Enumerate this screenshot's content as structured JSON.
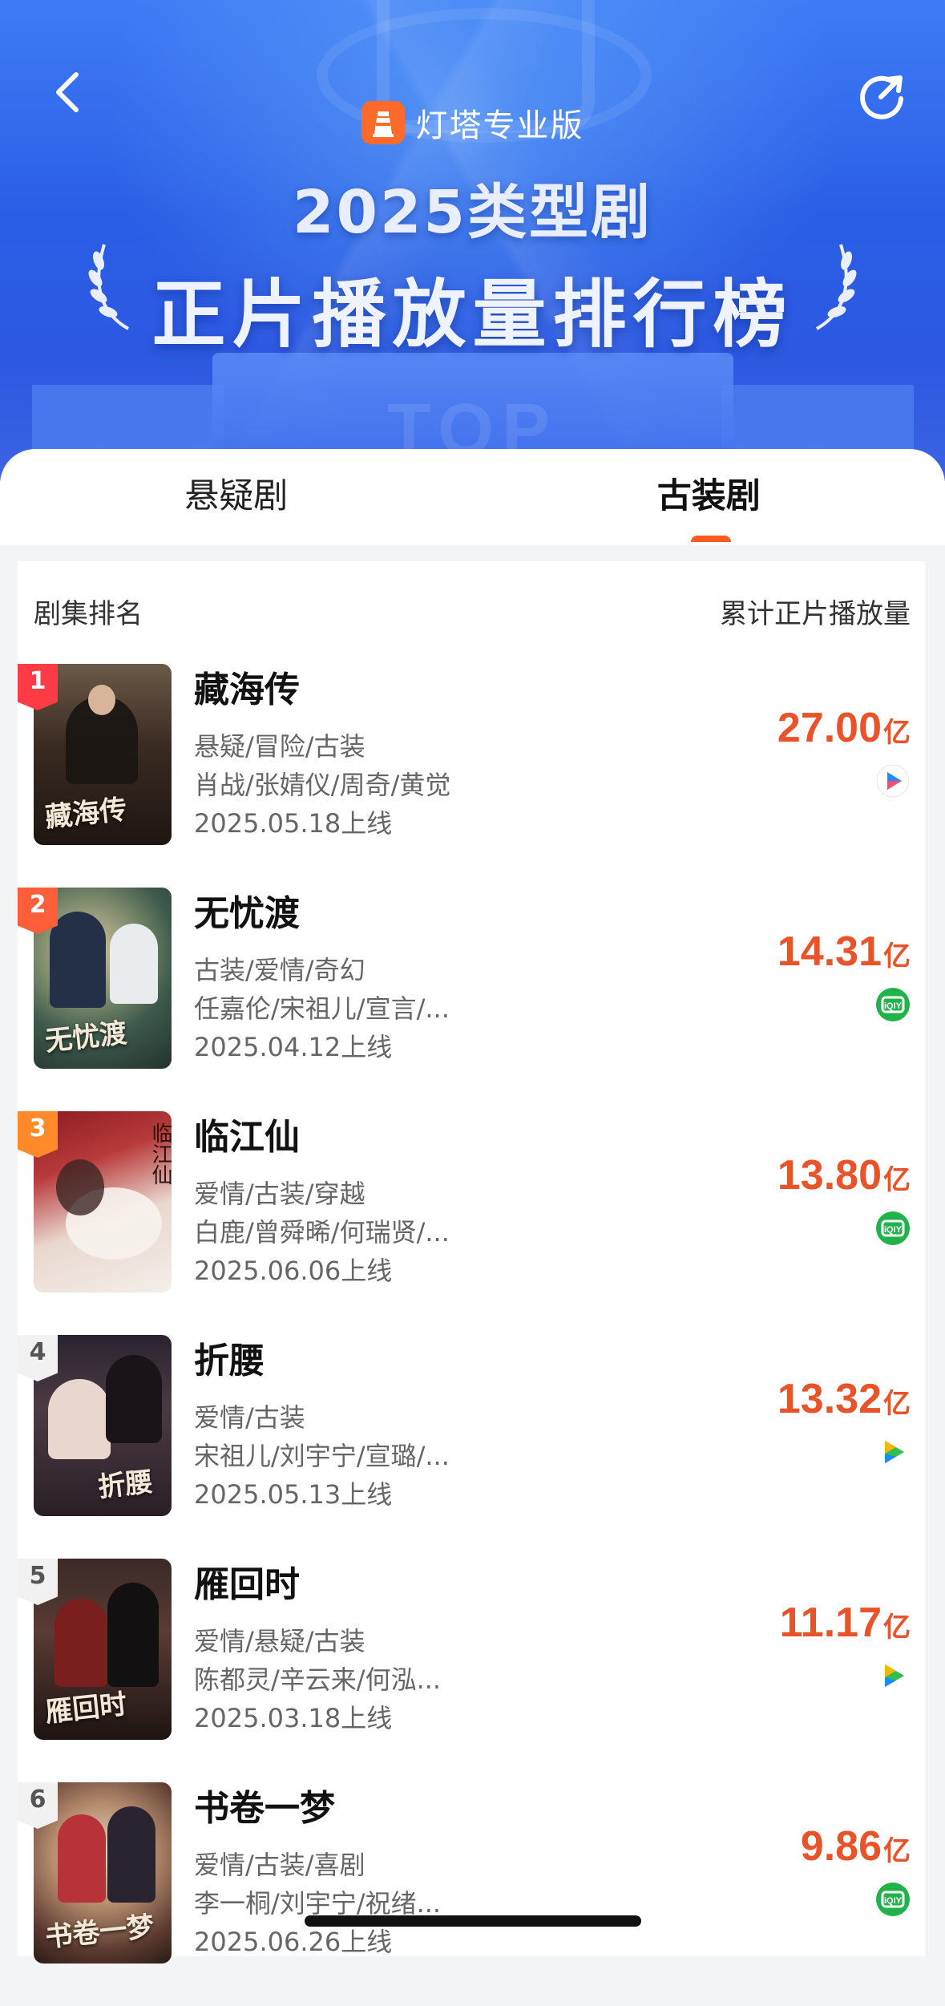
{
  "header": {
    "brand": "灯塔专业版",
    "title_line1": "2025类型剧",
    "title_line2": "正片播放量排行榜",
    "watermark": "TOP"
  },
  "tabs": [
    {
      "label": "悬疑剧",
      "active": false
    },
    {
      "label": "古装剧",
      "active": true
    }
  ],
  "columns": {
    "left": "剧集排名",
    "right": "累计正片播放量"
  },
  "colors": {
    "accent": "#e8532a",
    "tab_indicator": "#ff5a1f",
    "header_blue": "#2a5ee6"
  },
  "rows": [
    {
      "rank": "1",
      "title": "藏海传",
      "genres": "悬疑/冒险/古装",
      "cast": "肖战/张婧仪/周奇/黄觉",
      "date": "2025.05.18上线",
      "plays": "27.00",
      "unit": "亿",
      "platform": "youku-icon",
      "poster_text": "藏海传"
    },
    {
      "rank": "2",
      "title": "无忧渡",
      "genres": "古装/爱情/奇幻",
      "cast": "任嘉伦/宋祖儿/宣言/...",
      "date": "2025.04.12上线",
      "plays": "14.31",
      "unit": "亿",
      "platform": "iqiyi-icon",
      "poster_text": "无忧渡"
    },
    {
      "rank": "3",
      "title": "临江仙",
      "genres": "爱情/古装/穿越",
      "cast": "白鹿/曾舜晞/何瑞贤/...",
      "date": "2025.06.06上线",
      "plays": "13.80",
      "unit": "亿",
      "platform": "iqiyi-icon",
      "poster_text": "临江仙"
    },
    {
      "rank": "4",
      "title": "折腰",
      "genres": "爱情/古装",
      "cast": "宋祖儿/刘宇宁/宣璐/...",
      "date": "2025.05.13上线",
      "plays": "13.32",
      "unit": "亿",
      "platform": "tencent-video-icon",
      "poster_text": "折腰"
    },
    {
      "rank": "5",
      "title": "雁回时",
      "genres": "爱情/悬疑/古装",
      "cast": "陈都灵/辛云来/何泓...",
      "date": "2025.03.18上线",
      "plays": "11.17",
      "unit": "亿",
      "platform": "tencent-video-icon",
      "poster_text": "雁回时"
    },
    {
      "rank": "6",
      "title": "书卷一梦",
      "genres": "爱情/古装/喜剧",
      "cast": "李一桐/刘宇宁/祝绪...",
      "date": "2025.06.26上线",
      "plays": "9.86",
      "unit": "亿",
      "platform": "iqiyi-icon",
      "poster_text": "书卷一梦"
    }
  ]
}
